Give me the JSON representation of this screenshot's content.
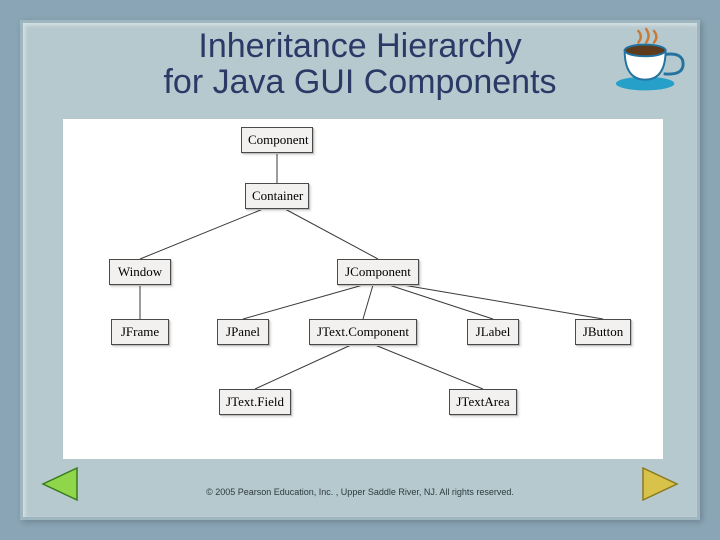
{
  "title_line1": "Inheritance Hierarchy",
  "title_line2": "for Java GUI Components",
  "nodes": {
    "component": "Component",
    "container": "Container",
    "window": "Window",
    "jcomponent": "JComponent",
    "jframe": "JFrame",
    "jpanel": "JPanel",
    "jtextcomponent": "JText.Component",
    "jlabel": "JLabel",
    "jbutton": "JButton",
    "jtextfield": "JText.Field",
    "jtextarea": "JTextArea"
  },
  "footer": "© 2005 Pearson Education, Inc. , Upper Saddle River, NJ.  All rights reserved."
}
